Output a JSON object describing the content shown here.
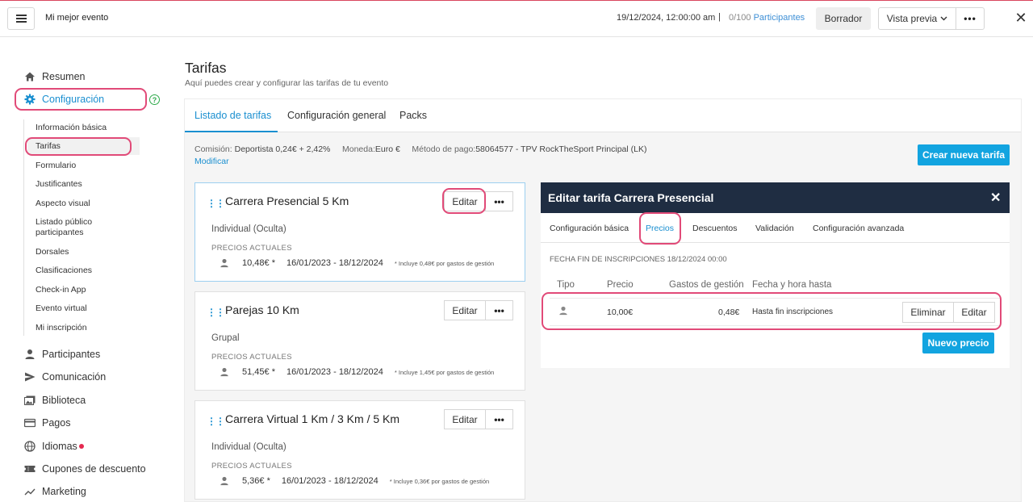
{
  "header": {
    "event_name": "Mi mejor evento",
    "datetime": "19/12/2024, 12:00:00 am",
    "separator": "|",
    "participants_count": "0/100",
    "participants_label": "Participantes",
    "draft_label": "Borrador",
    "preview_label": "Vista previa",
    "more_label": "•••",
    "close_label": "✕"
  },
  "sidebar": {
    "items": [
      {
        "label": "Resumen",
        "icon": "home-icon"
      },
      {
        "label": "Configuración",
        "icon": "gear-icon"
      },
      {
        "label": "Participantes",
        "icon": "person-icon"
      },
      {
        "label": "Comunicación",
        "icon": "send-icon"
      },
      {
        "label": "Biblioteca",
        "icon": "images-icon"
      },
      {
        "label": "Pagos",
        "icon": "card-icon"
      },
      {
        "label": "Idiomas",
        "icon": "globe-icon"
      },
      {
        "label": "Cupones de descuento",
        "icon": "coupon-icon"
      },
      {
        "label": "Marketing",
        "icon": "trend-icon"
      }
    ],
    "help_label": "?",
    "subitems": [
      "Información básica",
      "Tarifas",
      "Formulario",
      "Justificantes",
      "Aspecto visual",
      "Listado público participantes",
      "Dorsales",
      "Clasificaciones",
      "Check-in App",
      "Evento virtual",
      "Mi inscripción"
    ]
  },
  "main": {
    "title": "Tarifas",
    "subtitle": "Aquí puedes crear y configurar las tarifas de tu evento",
    "tabs": [
      "Listado de tarifas",
      "Configuración general",
      "Packs"
    ],
    "info": {
      "commission_label": "Comisión:",
      "commission_value": "Deportista 0,24€ + 2,42%",
      "currency_label": "Moneda:",
      "currency_value": "Euro €",
      "payment_label": "Método de pago:",
      "payment_value": "58064577 - TPV RockTheSport Principal (LK)",
      "modify_label": "Modificar"
    },
    "create_button": "Crear nueva tarifa",
    "cards": [
      {
        "title": "Carrera Presencial 5 Km",
        "edit": "Editar",
        "type": "Individual (Oculta)",
        "prices_label": "PRECIOS ACTUALES",
        "price": "10,48€ *",
        "dates": "16/01/2023 - 18/12/2024",
        "note": "* Incluye 0,48€ por gastos de gestión"
      },
      {
        "title": "Parejas 10 Km",
        "edit": "Editar",
        "type": "Grupal",
        "prices_label": "PRECIOS ACTUALES",
        "price": "51,45€ *",
        "dates": "16/01/2023 - 18/12/2024",
        "note": "* Incluye 1,45€ por gastos de gestión"
      },
      {
        "title": "Carrera Virtual 1 Km / 3 Km / 5 Km",
        "edit": "Editar",
        "type": "Individual (Oculta)",
        "prices_label": "PRECIOS ACTUALES",
        "price": "5,36€ *",
        "dates": "16/01/2023 - 18/12/2024",
        "note": "* Incluye 0,36€ por gastos de gestión"
      }
    ]
  },
  "modal": {
    "title": "Editar tarifa Carrera Presencial",
    "close": "✕",
    "tabs": [
      "Configuración básica",
      "Precios",
      "Descuentos",
      "Validación",
      "Configuración avanzada"
    ],
    "fecha_fin": "FECHA FIN DE INSCRIPCIONES 18/12/2024 00:00",
    "columns": [
      "Tipo",
      "Precio",
      "Gastos de gestión",
      "Fecha y hora hasta"
    ],
    "row": {
      "price": "10,00€",
      "fee": "0,48€",
      "until": "Hasta fin inscripciones"
    },
    "delete_button": "Eliminar",
    "edit_button": "Editar",
    "new_price_button": "Nuevo precio"
  },
  "colors": {
    "accent": "#1a8fd0",
    "highlight": "#e14a78",
    "modal_header": "#1f2d42",
    "primary_button": "#12a4e0"
  }
}
